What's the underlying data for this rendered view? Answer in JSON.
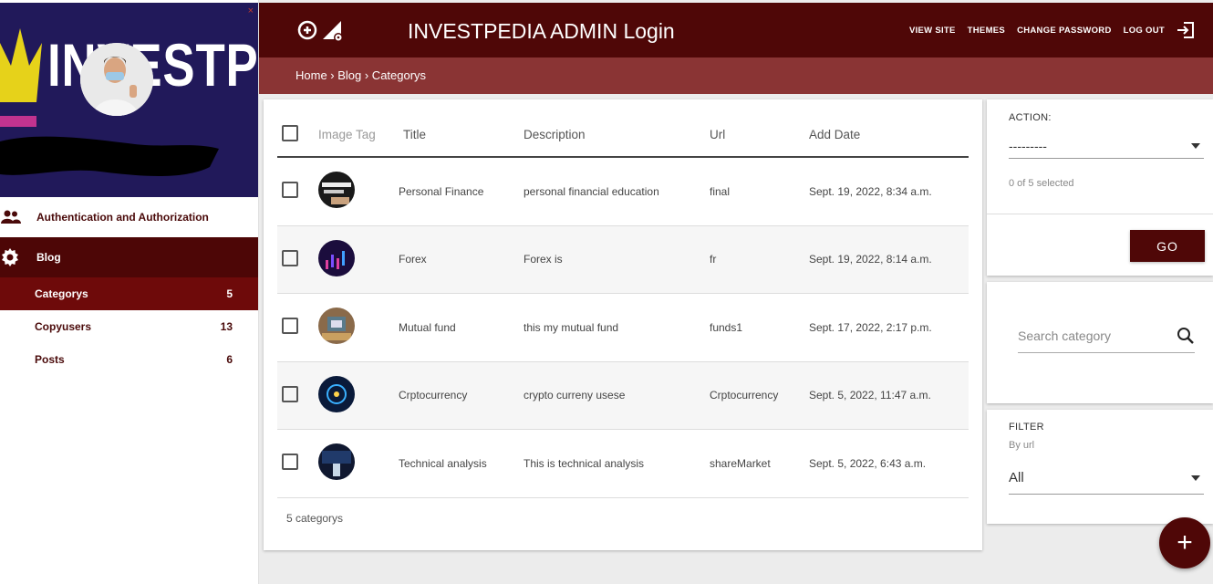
{
  "header": {
    "title": "INVESTPEDIA ADMIN Login",
    "nav": [
      "VIEW SITE",
      "THEMES",
      "CHANGE PASSWORD",
      "LOG OUT"
    ]
  },
  "breadcrumb": "Home › Blog › Categorys",
  "sidebar": {
    "banner_text": "INVESTPEDIA",
    "close": "×",
    "items": [
      {
        "label": "Authentication and Authorization",
        "icon": "users-icon"
      },
      {
        "label": "Blog",
        "icon": "gear-icon"
      }
    ],
    "subitems": [
      {
        "label": "Categorys",
        "count": "5"
      },
      {
        "label": "Copyusers",
        "count": "13"
      },
      {
        "label": "Posts",
        "count": "6"
      }
    ]
  },
  "table": {
    "columns": [
      "Image Tag",
      "Title",
      "Description",
      "Url",
      "Add Date"
    ],
    "rows": [
      {
        "title": "Personal Finance",
        "description": "personal financial education",
        "url": "final",
        "date": "Sept. 19, 2022, 8:34 a.m."
      },
      {
        "title": "Forex",
        "description": "Forex is",
        "url": "fr",
        "date": "Sept. 19, 2022, 8:14 a.m."
      },
      {
        "title": "Mutual fund",
        "description": "this my mutual fund",
        "url": "funds1",
        "date": "Sept. 17, 2022, 2:17 p.m."
      },
      {
        "title": "Crptocurrency",
        "description": "crypto curreny usese",
        "url": "Crptocurrency",
        "date": "Sept. 5, 2022, 11:47 a.m."
      },
      {
        "title": "Technical analysis",
        "description": "This is technical analysis",
        "url": "shareMarket",
        "date": "Sept. 5, 2022, 6:43 a.m."
      }
    ],
    "footer": "5 categorys"
  },
  "action": {
    "label": "ACTION:",
    "selected": "---------",
    "status": "0 of 5 selected",
    "go": "GO"
  },
  "search": {
    "placeholder": "Search category"
  },
  "filter": {
    "label": "FILTER",
    "sub": "By url",
    "value": "All"
  },
  "fab": "+"
}
